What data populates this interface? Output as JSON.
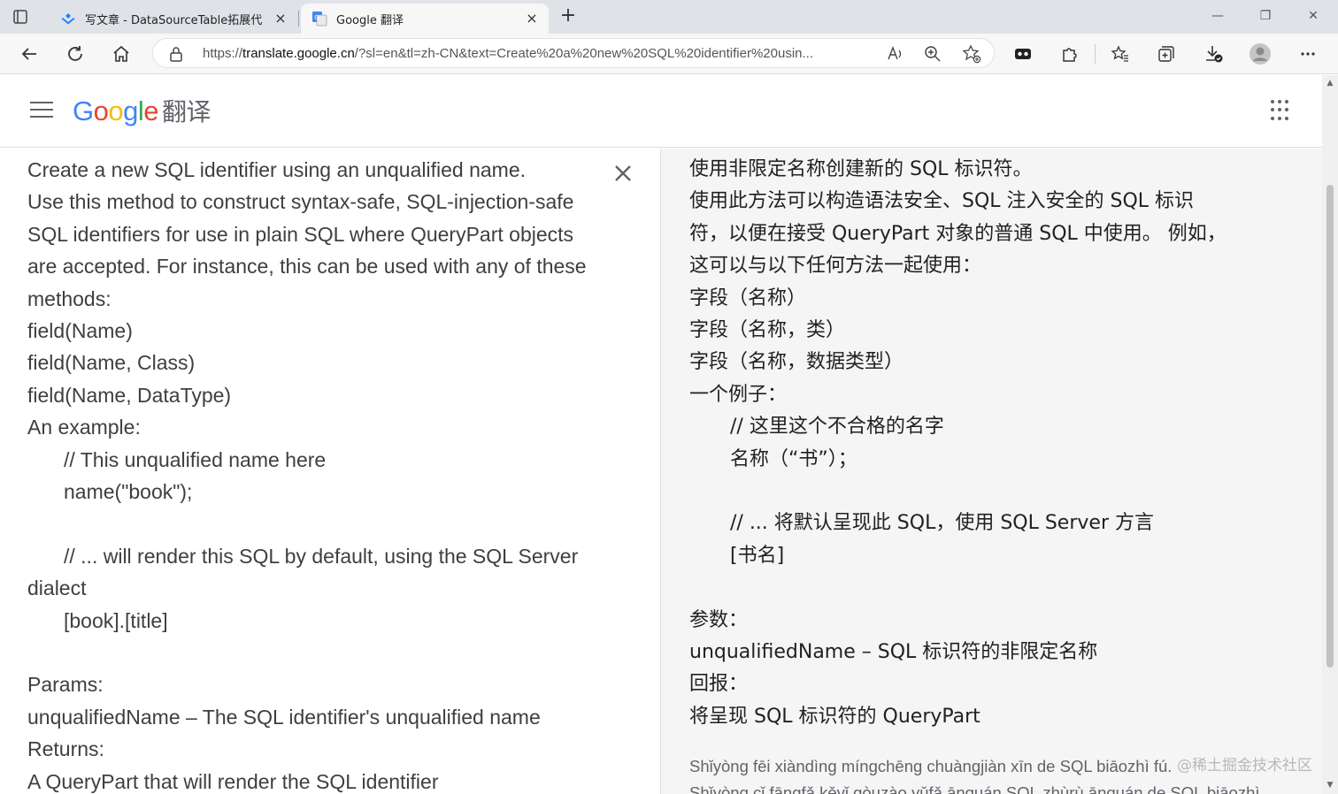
{
  "browser": {
    "tabs": [
      {
        "title": "写文章 - DataSourceTable拓展代",
        "close": "×"
      },
      {
        "title": "Google 翻译",
        "close": "×"
      }
    ],
    "new_tab": "+",
    "window_controls": {
      "minimize": "—",
      "restore": "❐",
      "close": "✕"
    },
    "url_prefix": "https://",
    "url_host": "translate.google.cn",
    "url_rest": "/?sl=en&tl=zh-CN&text=Create%20a%20new%20SQL%20identifier%20usin..."
  },
  "header": {
    "logo_letters": [
      "G",
      "o",
      "o",
      "g",
      "l",
      "e"
    ],
    "logo_colors": [
      "#4285F4",
      "#EA4335",
      "#FBBC05",
      "#4285F4",
      "#34A853",
      "#EA4335"
    ],
    "logo_suffix": "翻译"
  },
  "source": {
    "lines": [
      {
        "text": "Create a new SQL identifier using an unqualified name.",
        "indent": false
      },
      {
        "text": "Use this method to construct syntax-safe, SQL-injection-safe",
        "indent": false
      },
      {
        "text": "SQL identifiers for use in plain SQL where QueryPart objects",
        "indent": false
      },
      {
        "text": "are accepted. For instance, this can be used with any of these",
        "indent": false
      },
      {
        "text": "methods:",
        "indent": false
      },
      {
        "text": "field(Name)",
        "indent": false
      },
      {
        "text": "field(Name, Class)",
        "indent": false
      },
      {
        "text": "field(Name, DataType)",
        "indent": false
      },
      {
        "text": "An example:",
        "indent": false
      },
      {
        "text": "// This unqualified name here",
        "indent": true
      },
      {
        "text": "name(\"book\");",
        "indent": true
      },
      {
        "text": "",
        "indent": false
      },
      {
        "text": "// ... will render this SQL by default, using the SQL Server",
        "indent": true
      },
      {
        "text": "dialect",
        "indent": false
      },
      {
        "text": "[book].[title]",
        "indent": true
      },
      {
        "text": "",
        "indent": false
      },
      {
        "text": "Params:",
        "indent": false
      },
      {
        "text": "unqualifiedName – The SQL identifier's unqualified name",
        "indent": false
      },
      {
        "text": "Returns:",
        "indent": false
      },
      {
        "text": "A QueryPart that will render the SQL identifier",
        "indent": false
      }
    ]
  },
  "target": {
    "lines": [
      {
        "text": "使用非限定名称创建新的 SQL 标识符。",
        "indent": false
      },
      {
        "text": "使用此方法可以构造语法安全、SQL 注入安全的 SQL 标识",
        "indent": false
      },
      {
        "text": "符，以便在接受 QueryPart 对象的普通 SQL 中使用。 例如，",
        "indent": false
      },
      {
        "text": "这可以与以下任何方法一起使用：",
        "indent": false
      },
      {
        "text": "字段（名称）",
        "indent": false
      },
      {
        "text": "字段（名称，类）",
        "indent": false
      },
      {
        "text": "字段（名称，数据类型）",
        "indent": false
      },
      {
        "text": "一个例子：",
        "indent": false
      },
      {
        "text": "// 这里这个不合格的名字",
        "indent": true
      },
      {
        "text": "名称（“书”）；",
        "indent": true
      },
      {
        "text": "",
        "indent": false
      },
      {
        "text": "// ... 将默认呈现此 SQL，使用 SQL Server 方言",
        "indent": true
      },
      {
        "text": "[书名]",
        "indent": true
      },
      {
        "text": "",
        "indent": false
      },
      {
        "text": "参数：",
        "indent": false
      },
      {
        "text": "unqualifiedName – SQL 标识符的非限定名称",
        "indent": false
      },
      {
        "text": "回报：",
        "indent": false
      },
      {
        "text": "将呈现 SQL 标识符的 QueryPart",
        "indent": false
      }
    ],
    "romanization": [
      "Shǐyòng fēi xiàndìng míngchēng chuàngjiàn xīn de SQL biāozhì fú.",
      "Shǐyòng cǐ fāngfǎ kěyǐ gòuzào yǔfǎ ānquán SQL zhùrù ānquán de SQL biāozhì"
    ]
  },
  "watermark": "@稀土掘金技术社区",
  "scrollbar": {
    "up": "▲",
    "down": "▼"
  }
}
